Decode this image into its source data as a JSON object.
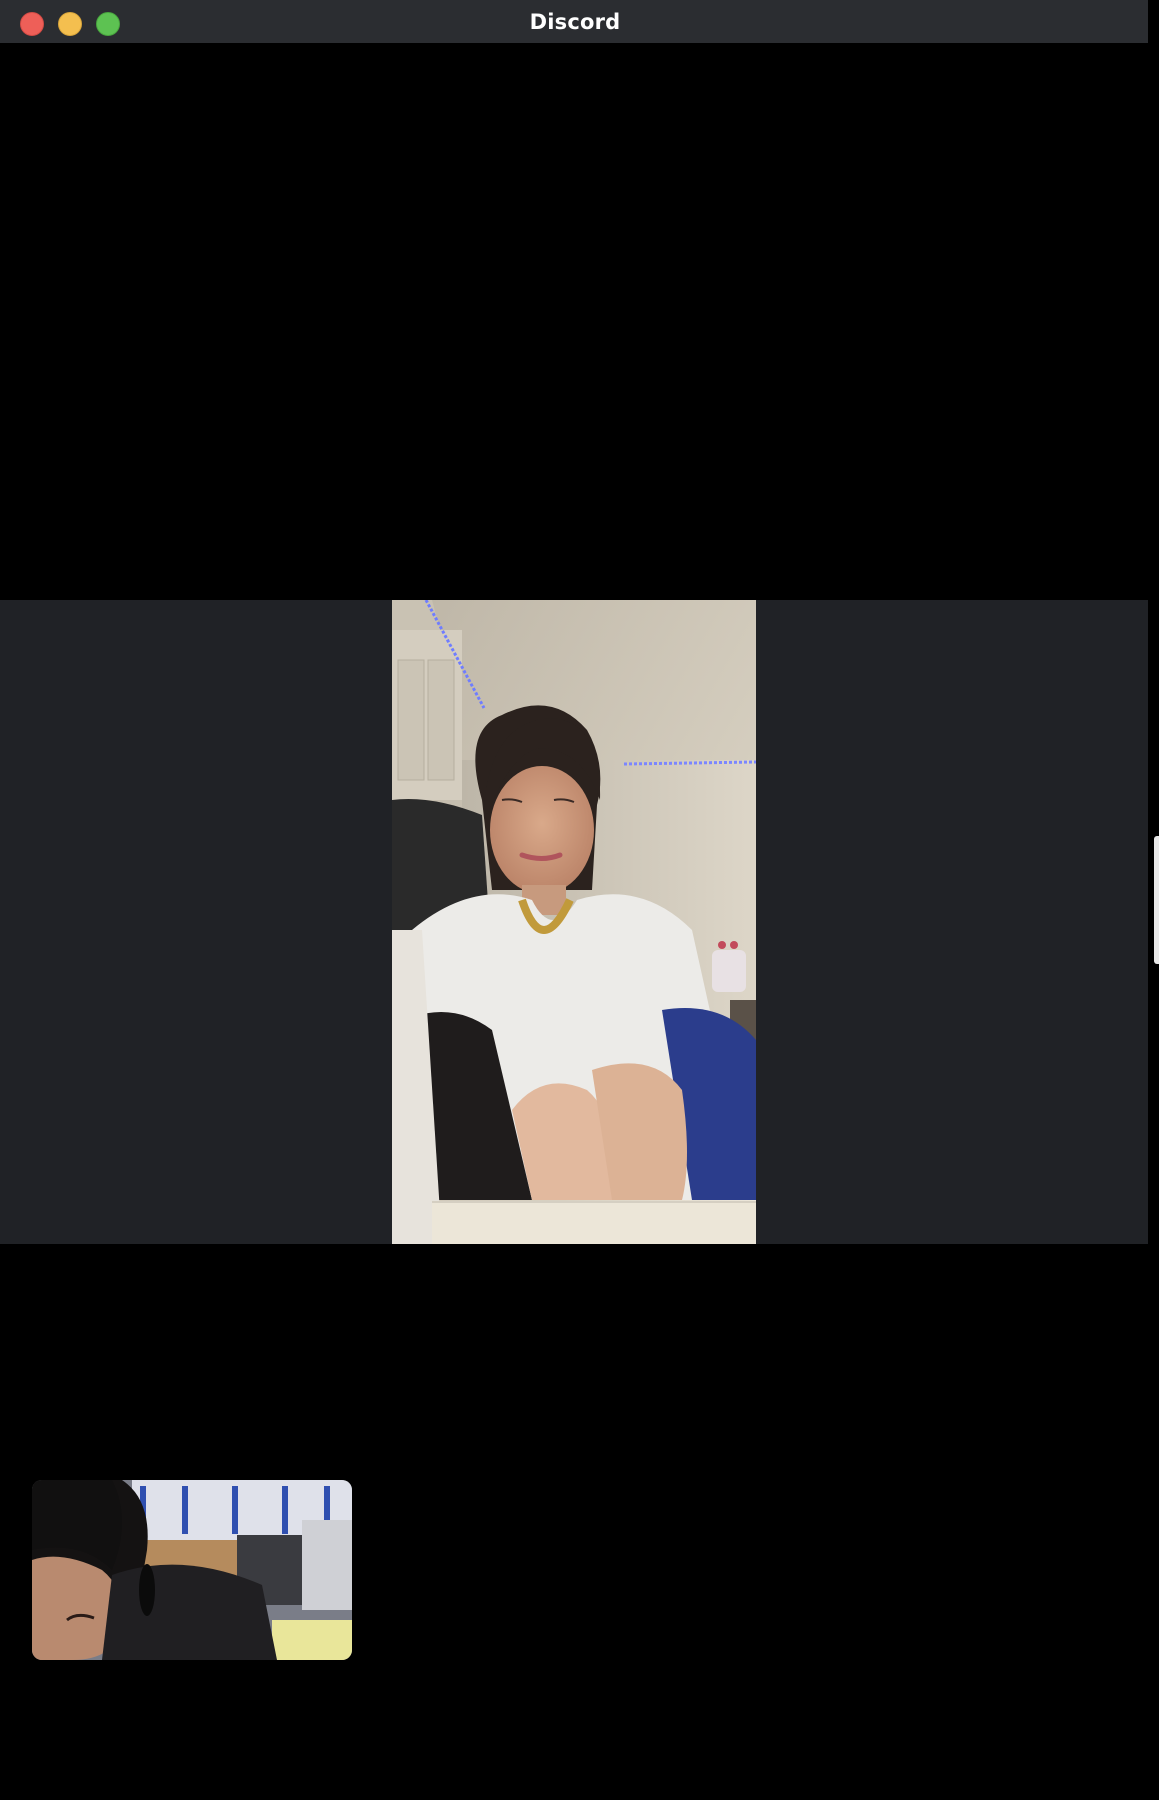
{
  "window": {
    "title": "Discord"
  },
  "titlebar": {
    "close_icon": "close-dot-icon",
    "minimize_icon": "minimize-dot-icon",
    "zoom_icon": "zoom-dot-icon"
  },
  "colors": {
    "titlebar_bg": "#2b2d31",
    "stage_bg": "#202226",
    "window_bg": "#000000",
    "close": "#ee5f58",
    "minimize": "#f4bf4f",
    "zoom": "#5dc252"
  }
}
